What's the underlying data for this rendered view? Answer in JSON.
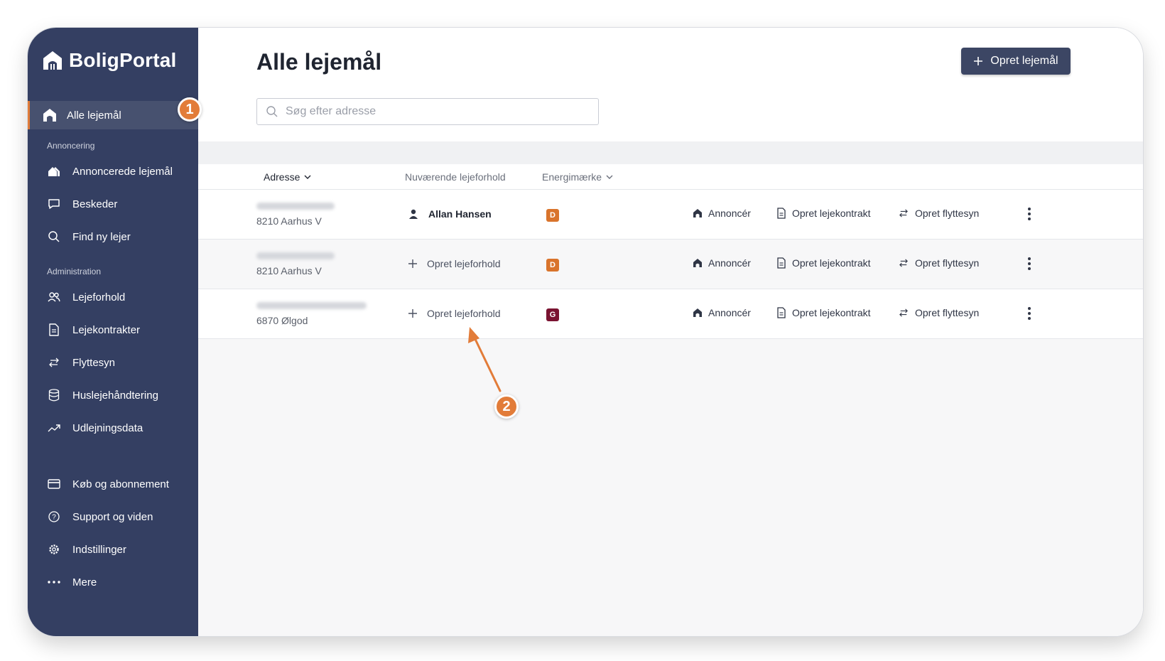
{
  "app": {
    "brand": "BoligPortal"
  },
  "sidebar": {
    "active_item": "Alle lejemål",
    "sections": [
      {
        "label": "Annoncering",
        "items": [
          "Annoncerede lejemål",
          "Besked er"
        ]
      },
      {
        "label": "Administration"
      }
    ],
    "annoncering_label": "Annoncering",
    "administration_label": "Administration",
    "items": {
      "annoncerede": "Annoncerede lejemål",
      "beskeder": "Beskeder",
      "find_lejer": "Find ny lejer",
      "lejeforhold": "Lejeforhold",
      "lejekontrakter": "Lejekontrakter",
      "flyttesyn": "Flyttesyn",
      "huslejehaandtering": "Huslejehåndtering",
      "udlejningsdata": "Udlejningsdata",
      "koeb": "Køb og abonnement",
      "support": "Support og viden",
      "indstillinger": "Indstillinger",
      "mere": "Mere"
    }
  },
  "header": {
    "title": "Alle lejemål",
    "create_button": "Opret lejemål",
    "search_placeholder": "Søg efter adresse"
  },
  "table": {
    "columns": {
      "address": "Adresse",
      "tenancy": "Nuværende lejeforhold",
      "energy": "Energimærke"
    },
    "rows": [
      {
        "city": "8210 Aarhus V",
        "tenant": "Allan Hansen",
        "energy": "D",
        "energy_color": "#d9742c"
      },
      {
        "city": "8210 Aarhus V",
        "tenant_action": "Opret lejeforhold",
        "energy": "D",
        "energy_color": "#d9742c"
      },
      {
        "city": "6870 Ølgod",
        "tenant_action": "Opret lejeforhold",
        "energy": "G",
        "energy_color": "#7a1331"
      }
    ],
    "actions": {
      "advertise": "Annoncér",
      "contract": "Opret lejekontrakt",
      "inspection": "Opret flyttesyn"
    }
  },
  "markers": {
    "one": "1",
    "two": "2"
  },
  "colors": {
    "sidebar": "#343f62",
    "accent": "#e27c39",
    "button": "#3c4664"
  }
}
